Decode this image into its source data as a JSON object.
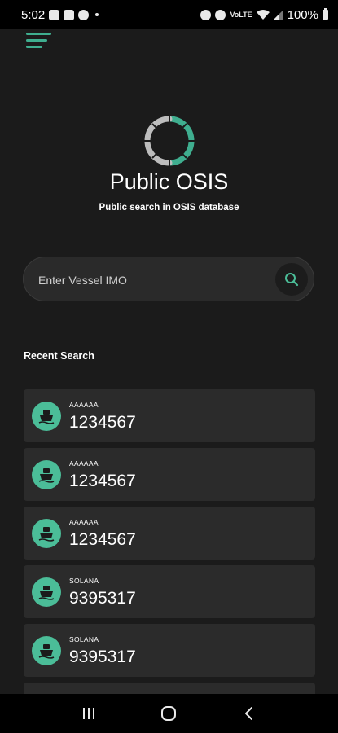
{
  "status_bar": {
    "time": "5:02",
    "battery": "100%",
    "left_icons": [
      "gallery-icon",
      "calendar-icon",
      "whatsapp-icon"
    ],
    "right_icons": [
      "alarm-icon",
      "hotspot-icon",
      "volte-icon",
      "wifi-icon",
      "signal-icon",
      "battery-icon"
    ],
    "volte_label": "VoLTE"
  },
  "header": {
    "menu_icon": "hamburger-menu-icon"
  },
  "brand": {
    "logo_icon": "osis-logo-icon",
    "title": "Public OSIS",
    "subtitle": "Public search in OSIS database"
  },
  "search": {
    "placeholder": "Enter Vessel IMO",
    "value": "",
    "button_icon": "search-icon"
  },
  "recent": {
    "title": "Recent Search",
    "items": [
      {
        "name": "AAAAAA",
        "imo": "1234567",
        "icon": "ship-icon"
      },
      {
        "name": "AAAAAA",
        "imo": "1234567",
        "icon": "ship-icon"
      },
      {
        "name": "AAAAAA",
        "imo": "1234567",
        "icon": "ship-icon"
      },
      {
        "name": "SOLANA",
        "imo": "9395317",
        "icon": "ship-icon"
      },
      {
        "name": "SOLANA",
        "imo": "9395317",
        "icon": "ship-icon"
      }
    ]
  },
  "colors": {
    "accent": "#3fae8f",
    "avatar": "#4bbd98",
    "background": "#1b1b1b",
    "card": "#2b2b2b"
  },
  "nav_bar": {
    "icons": [
      "recent-apps-icon",
      "home-icon",
      "back-icon"
    ]
  }
}
